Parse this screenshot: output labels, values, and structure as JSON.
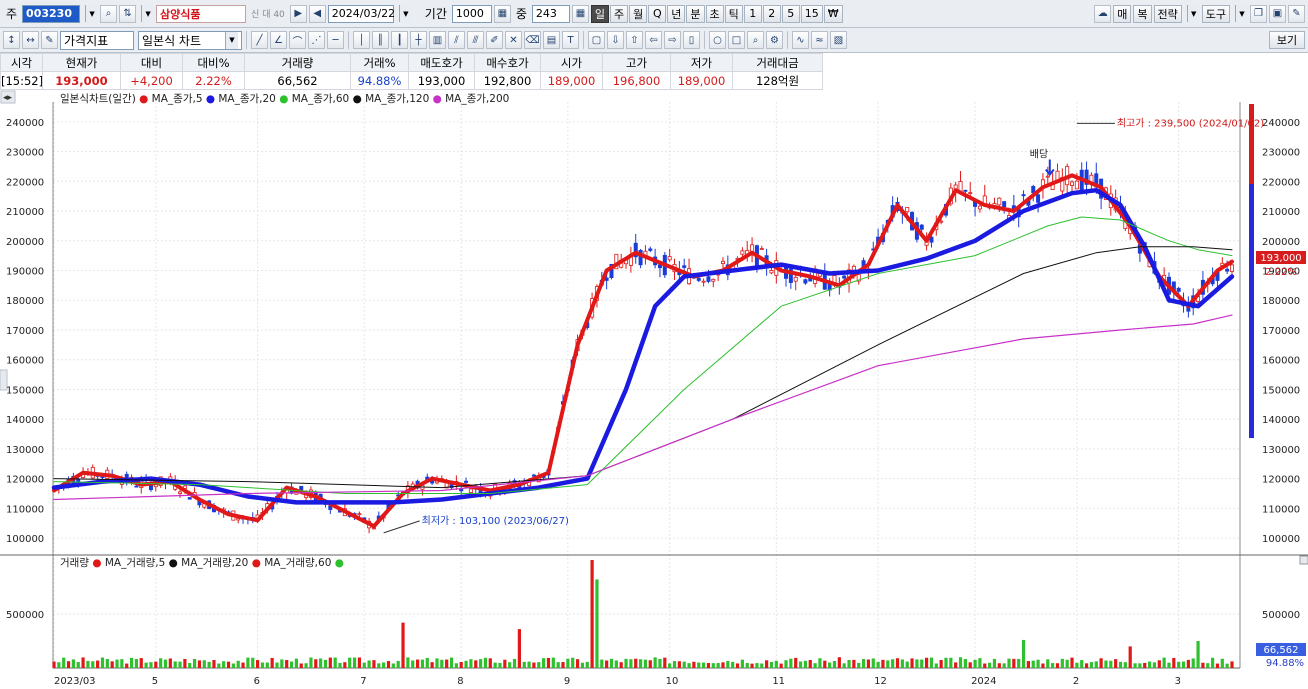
{
  "toolbar": {
    "market_label": "주",
    "code": "003230",
    "name": "삼양식품",
    "name_tags": "신 대 40",
    "date": "2024/03/22",
    "period_label": "기간",
    "period_value": "1000",
    "overlap_label": "중",
    "overlap_value": "243",
    "periods": [
      "일",
      "주",
      "월",
      "Q",
      "년",
      "분",
      "초",
      "틱",
      "1",
      "2",
      "5",
      "15",
      "₩"
    ],
    "right_buttons": [
      "매",
      "복",
      "전략",
      "도구"
    ]
  },
  "toolbar2": {
    "indicator_select": "가격지표",
    "chart_type_select": "일본식 차트",
    "view_button": "보기"
  },
  "quote": {
    "headers": [
      "시각",
      "현재가",
      "대비",
      "대비%",
      "거래량",
      "거래%",
      "매도호가",
      "매수호가",
      "시가",
      "고가",
      "저가",
      "거래대금"
    ],
    "values": [
      "[15:52]",
      "193,000",
      "+4,200",
      "2.22%",
      "66,562",
      "94.88%",
      "193,000",
      "192,800",
      "189,000",
      "196,800",
      "189,000",
      "128억원"
    ],
    "colors": [
      "#000000",
      "#d21b1b",
      "#d21b1b",
      "#d21b1b",
      "#000000",
      "#1941c8",
      "#000000",
      "#000000",
      "#d21b1b",
      "#d21b1b",
      "#d21b1b",
      "#000000"
    ]
  },
  "chart_data": [
    {
      "type": "line",
      "title": "일본식차트(일간)",
      "legend": [
        "MA_종가,5",
        "MA_종가,20",
        "MA_종가,60",
        "MA_종가,120",
        "MA_종가,200"
      ],
      "ylim": [
        96000,
        246000
      ],
      "yticks": [
        100000,
        110000,
        120000,
        130000,
        140000,
        150000,
        160000,
        170000,
        180000,
        190000,
        200000,
        210000,
        220000,
        230000,
        240000
      ],
      "ytick_labels": [
        "100000",
        "110000",
        "120000",
        "130000",
        "140000",
        "150000",
        "160000",
        "170000",
        "180000",
        "190000",
        "200000",
        "210000",
        "220000",
        "230000",
        "240000"
      ],
      "xtick_labels": [
        "2023/03",
        "5",
        "6",
        "7",
        "8",
        "9",
        "10",
        "11",
        "12",
        "2024",
        "2",
        "3"
      ],
      "series": [
        {
          "name": "MA_종가,5",
          "color": "#e01818",
          "x": [
            0,
            6,
            12,
            18,
            24,
            30,
            36,
            42,
            48,
            54,
            60,
            66,
            72,
            78,
            84,
            90,
            96,
            102,
            108,
            114,
            120,
            126,
            132,
            138,
            144,
            150,
            156,
            162,
            168,
            174,
            180,
            186,
            192,
            198,
            204,
            210,
            216,
            222,
            228,
            234,
            240,
            243
          ],
          "y": [
            116000,
            122000,
            121000,
            118000,
            119000,
            113000,
            108000,
            106000,
            117000,
            114000,
            109000,
            104000,
            115000,
            120000,
            118000,
            116000,
            118000,
            122000,
            165000,
            190000,
            196000,
            192000,
            188000,
            190000,
            196000,
            190000,
            188000,
            185000,
            192000,
            212000,
            200000,
            217000,
            212000,
            210000,
            218000,
            222000,
            218000,
            205000,
            188000,
            178000,
            190000,
            193000
          ]
        },
        {
          "name": "MA_종가,20",
          "color": "#1a1ae0",
          "x": [
            0,
            10,
            20,
            30,
            40,
            50,
            60,
            70,
            80,
            90,
            100,
            110,
            118,
            124,
            130,
            140,
            150,
            160,
            170,
            180,
            190,
            200,
            210,
            215,
            220,
            225,
            230,
            236,
            243
          ],
          "y": [
            117000,
            119000,
            120000,
            118000,
            114000,
            112000,
            112000,
            112000,
            113000,
            115000,
            117000,
            120000,
            150000,
            178000,
            188000,
            190000,
            192000,
            189000,
            190000,
            194000,
            200000,
            210000,
            216000,
            217000,
            212000,
            198000,
            180000,
            178000,
            188000
          ]
        },
        {
          "name": "MA_종가,60",
          "color": "#2ec02e",
          "x": [
            0,
            30,
            60,
            90,
            110,
            130,
            150,
            170,
            190,
            205,
            212,
            220,
            230,
            236,
            243
          ],
          "y": [
            119000,
            118000,
            115000,
            115000,
            118000,
            150000,
            178000,
            189000,
            195000,
            205000,
            208000,
            207000,
            200000,
            197000,
            195000
          ]
        },
        {
          "name": "MA_종가,120",
          "color": "#111111",
          "x": [
            0,
            40,
            80,
            110,
            140,
            170,
            200,
            215,
            224,
            235,
            243
          ],
          "y": [
            120000,
            119000,
            117000,
            121000,
            140000,
            165000,
            189000,
            196000,
            198000,
            198000,
            197000
          ]
        },
        {
          "name": "MA_종가,200",
          "color": "#c832c8",
          "x": [
            0,
            40,
            80,
            110,
            140,
            170,
            200,
            220,
            235,
            243
          ],
          "y": [
            113000,
            115000,
            116000,
            121000,
            140000,
            158000,
            167000,
            170000,
            172000,
            175000
          ]
        }
      ],
      "annotations": [
        {
          "text": "최고가 : 239,500 (2024/01/02)",
          "x": 211,
          "y": 239500
        },
        {
          "text": "최저가 : 103,100 (2023/06/27)",
          "x": 68,
          "y": 103100
        },
        {
          "text": "배당",
          "x": 205,
          "y": 228000
        }
      ],
      "right_labels": {
        "price": "193,000",
        "change": "2.22%"
      }
    },
    {
      "type": "bar",
      "title": "거래량",
      "legend": [
        "MA_거래량,5",
        "MA_거래량,20",
        "MA_거래량,60"
      ],
      "ylim": [
        0,
        1000000
      ],
      "yticks": [
        500000
      ],
      "ytick_labels": [
        "500000"
      ],
      "spikes": [
        {
          "x": 72,
          "v": 420000
        },
        {
          "x": 96,
          "v": 360000
        },
        {
          "x": 111,
          "v": 1000000
        },
        {
          "x": 112,
          "v": 820000
        },
        {
          "x": 200,
          "v": 260000
        },
        {
          "x": 222,
          "v": 200000
        },
        {
          "x": 236,
          "v": 250000
        }
      ],
      "right_labels": {
        "volume": "66,562",
        "ratio": "94.88%"
      }
    }
  ]
}
